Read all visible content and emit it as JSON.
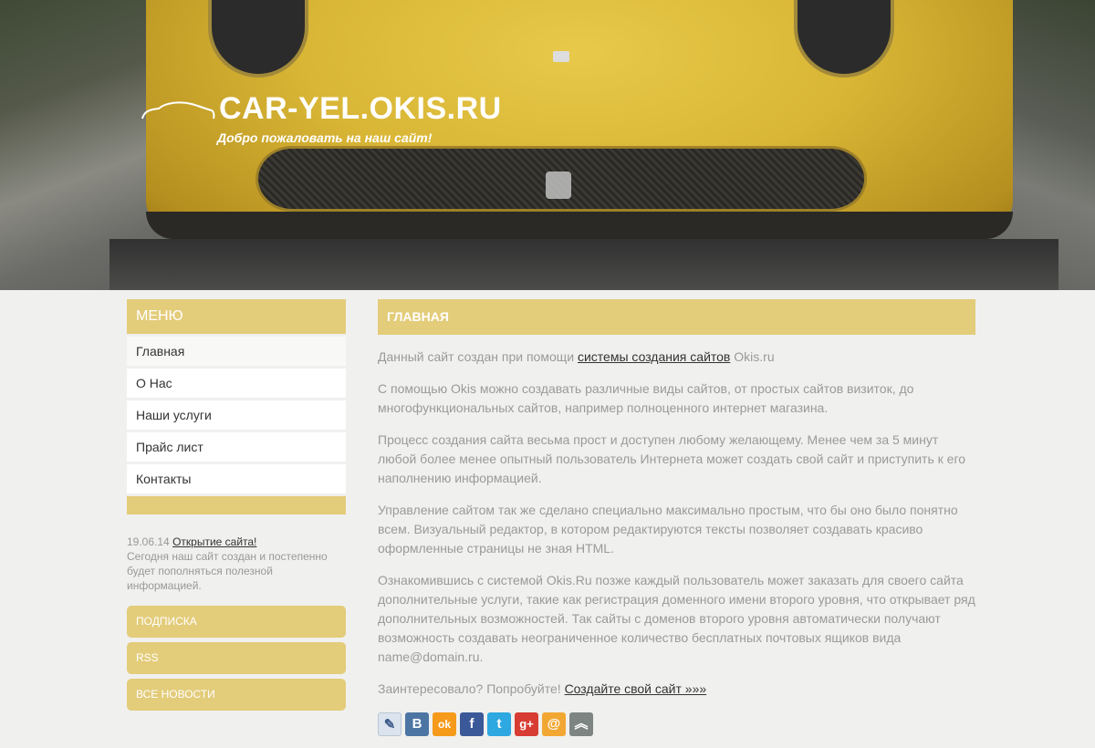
{
  "header": {
    "title": "CAR-YEL.OKIS.RU",
    "slogan": "Добро пожаловать на наш сайт!"
  },
  "sidebar": {
    "menu_title": "МЕНЮ",
    "items": [
      {
        "label": "Главная"
      },
      {
        "label": "О Нас"
      },
      {
        "label": "Наши услуги"
      },
      {
        "label": "Прайс лист"
      },
      {
        "label": "Контакты"
      }
    ],
    "news": {
      "date": "19.06.14",
      "title": "Открытие сайта!",
      "text": "Сегодня наш сайт создан и постепенно будет пополняться полезной информацией."
    },
    "buttons": [
      "ПОДПИСКА",
      "RSS",
      "ВСЕ НОВОСТИ"
    ]
  },
  "main": {
    "title": "ГЛАВНАЯ",
    "p1_before": "Данный сайт создан при помощи ",
    "p1_link": "системы создания сайтов",
    "p1_after": " Okis.ru",
    "p2": "С помощью Okis можно создавать различные виды сайтов, от простых сайтов визиток, до многофункциональных сайтов, например полноценного интернет магазина.",
    "p3": "Процесс создания сайта весьма прост и доступен любому желающему. Менее чем за 5 минут любой более менее опытный пользователь Интернета может создать свой сайт и приступить к его наполнению информацией.",
    "p4": "Управление сайтом так же сделано специально максимально простым, что бы оно было понятно всем. Визуальный редактор, в котором редактируются тексты позволяет создавать красиво оформленные страницы не зная HTML.",
    "p5": "Ознакомившись с системой Okis.Ru позже каждый пользователь может заказать для своего сайта дополнительные услуги, такие как регистрация доменного имени второго уровня, что открывает ряд дополнительных возможностей. Так сайты с доменов второго уровня автоматически получают возможность создавать неограниченное количество бесплатных почтовых ящиков вида name@domain.ru.",
    "p6_before": "Заинтересовало? Попробуйте! ",
    "p6_link": "Создайте свой сайт »»»"
  },
  "share_icons": [
    {
      "name": "livejournal-icon",
      "glyph": "✎",
      "color": "#dbe4ee"
    },
    {
      "name": "vkontakte-icon",
      "glyph": "B",
      "color": "#4c75a3"
    },
    {
      "name": "odnoklassniki-icon",
      "glyph": "ok",
      "color": "#f59a1b"
    },
    {
      "name": "facebook-icon",
      "glyph": "f",
      "color": "#3b5998"
    },
    {
      "name": "twitter-icon",
      "glyph": "t",
      "color": "#2ea8e0"
    },
    {
      "name": "googleplus-icon",
      "glyph": "g+",
      "color": "#d73d32"
    },
    {
      "name": "mailru-icon",
      "glyph": "@",
      "color": "#f2a733"
    },
    {
      "name": "more-icon",
      "glyph": "︽",
      "color": "#7d8583"
    }
  ],
  "colors": {
    "accent": "#e3cc7a",
    "background": "#f0f0ee",
    "text": "#9a9a9a"
  }
}
